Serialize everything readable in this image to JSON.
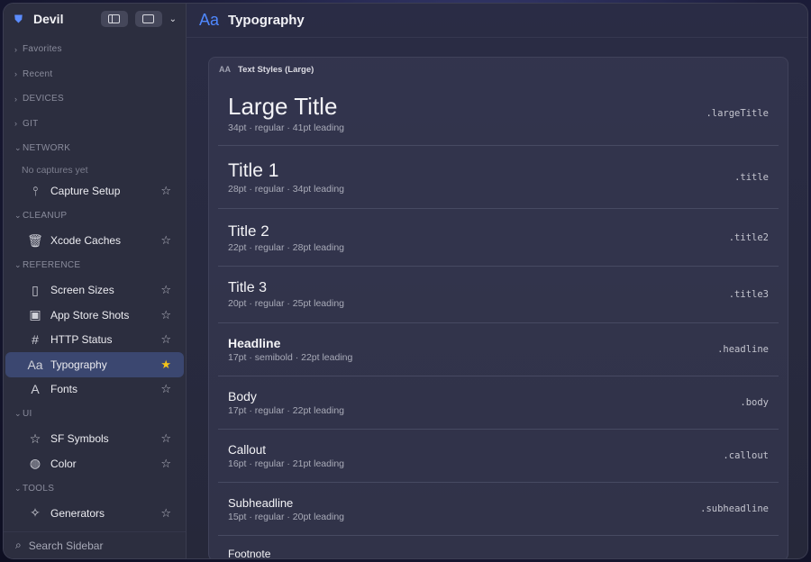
{
  "app": {
    "name": "Devil"
  },
  "sidebar": {
    "sections": {
      "favorites": "Favorites",
      "recent": "Recent",
      "devices": "DEVICES",
      "git": "GIT",
      "network": "NETWORK",
      "cleanup": "CLEANUP",
      "reference": "REFERENCE",
      "ui": "UI",
      "tools": "TOOLS"
    },
    "network_placeholder": "No captures yet",
    "items": {
      "capture_setup": "Capture Setup",
      "xcode_caches": "Xcode Caches",
      "screen_sizes": "Screen Sizes",
      "app_store_shots": "App Store Shots",
      "http_status": "HTTP Status",
      "typography": "Typography",
      "fonts": "Fonts",
      "sf_symbols": "SF Symbols",
      "color": "Color",
      "generators": "Generators"
    },
    "search_placeholder": "Search Sidebar"
  },
  "main": {
    "title": "Typography",
    "title_icon": "Aa",
    "card_title": "Text Styles (Large)",
    "card_icon": "AA",
    "styles": [
      {
        "name": "Large Title",
        "meta": "34pt · regular · 41pt leading",
        "code": ".largeTitle"
      },
      {
        "name": "Title 1",
        "meta": "28pt · regular · 34pt leading",
        "code": ".title"
      },
      {
        "name": "Title 2",
        "meta": "22pt · regular · 28pt leading",
        "code": ".title2"
      },
      {
        "name": "Title 3",
        "meta": "20pt · regular · 25pt leading",
        "code": ".title3"
      },
      {
        "name": "Headline",
        "meta": "17pt · semibold · 22pt leading",
        "code": ".headline"
      },
      {
        "name": "Body",
        "meta": "17pt · regular · 22pt leading",
        "code": ".body"
      },
      {
        "name": "Callout",
        "meta": "16pt · regular · 21pt leading",
        "code": ".callout"
      },
      {
        "name": "Subheadline",
        "meta": "15pt · regular · 20pt leading",
        "code": ".subheadline"
      },
      {
        "name": "Footnote",
        "meta": "",
        "code": ""
      }
    ]
  },
  "colors": {
    "accent": "#4f88ff",
    "selected_bg": "#3b4770",
    "favorite_star": "#f5c518"
  }
}
